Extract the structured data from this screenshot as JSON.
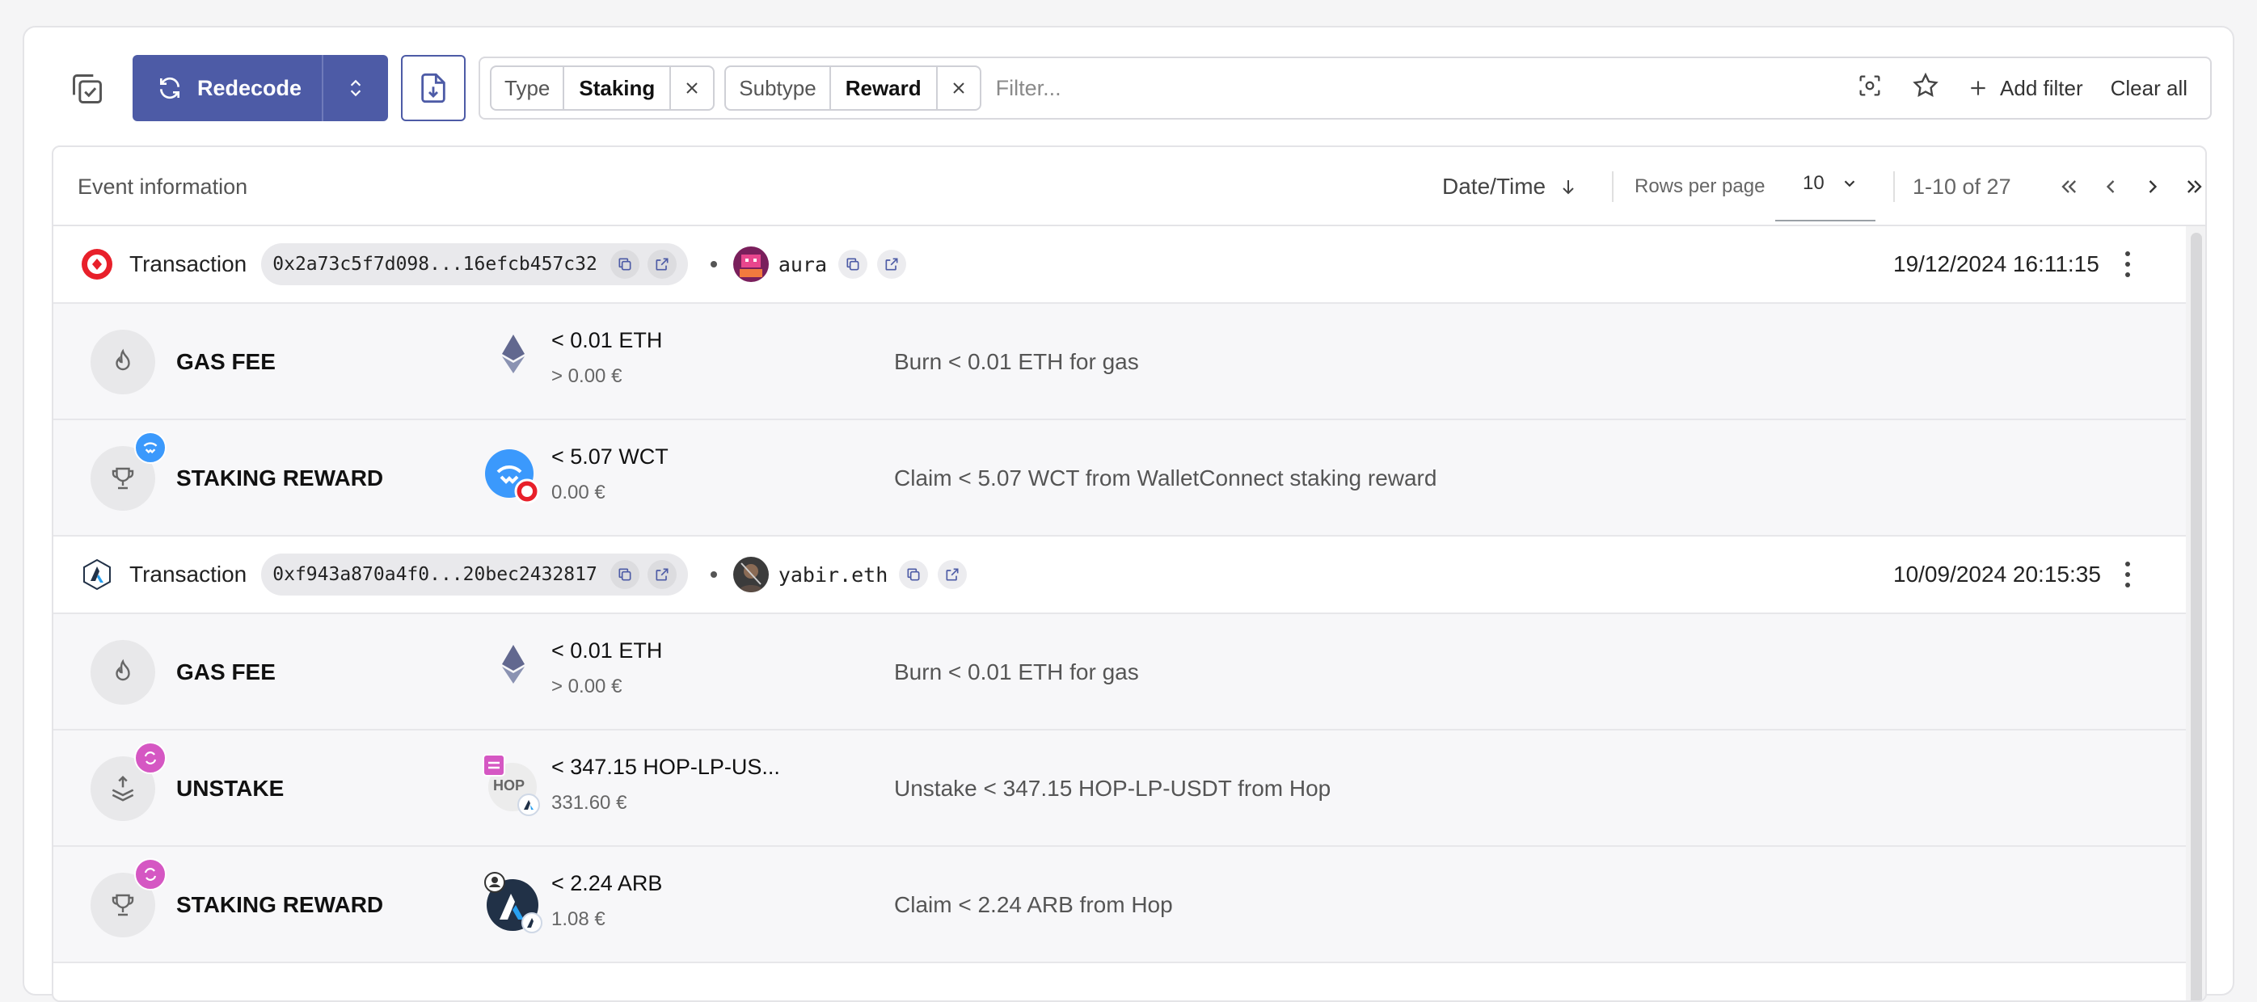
{
  "toolbar": {
    "redecode_label": "Redecode",
    "filters": [
      {
        "key": "Type",
        "value": "Staking"
      },
      {
        "key": "Subtype",
        "value": "Reward"
      }
    ],
    "filter_placeholder": "Filter...",
    "add_filter_label": "Add filter",
    "clear_all_label": "Clear all"
  },
  "table": {
    "header_title": "Event information",
    "sort_label": "Date/Time",
    "rows_per_page_label": "Rows per page",
    "rows_per_page_value": "10",
    "range_label": "1-10 of 27"
  },
  "transactions": [
    {
      "label": "Transaction",
      "hash": "0x2a73c5f7d098...16efcb457c32",
      "account": "aura",
      "datetime": "19/12/2024 16:11:15",
      "events": [
        {
          "type": "GAS FEE",
          "amount": "< 0.01 ETH",
          "fiat": "> 0.00 €",
          "notes": "Burn < 0.01 ETH for gas"
        },
        {
          "type": "STAKING REWARD",
          "amount": "< 5.07 WCT",
          "fiat": "0.00 €",
          "notes": "Claim < 5.07 WCT from WalletConnect staking reward"
        }
      ]
    },
    {
      "label": "Transaction",
      "hash": "0xf943a870a4f0...20bec2432817",
      "account": "yabir.eth",
      "datetime": "10/09/2024 20:15:35",
      "events": [
        {
          "type": "GAS FEE",
          "amount": "< 0.01 ETH",
          "fiat": "> 0.00 €",
          "notes": "Burn < 0.01 ETH for gas"
        },
        {
          "type": "UNSTAKE",
          "amount": "< 347.15 HOP-LP-US...",
          "fiat": "331.60 €",
          "notes": "Unstake < 347.15 HOP-LP-USDT from Hop",
          "asset_text": "HOP"
        },
        {
          "type": "STAKING REWARD",
          "amount": "< 2.24 ARB",
          "fiat": "1.08 €",
          "notes": "Claim < 2.24 ARB from Hop"
        }
      ]
    }
  ],
  "colors": {
    "accent": "#4d5ba6",
    "optimism": "#e8202a",
    "walletconnect": "#3b99fc",
    "hop": "#d557c3",
    "arbitrum": "#213147"
  }
}
